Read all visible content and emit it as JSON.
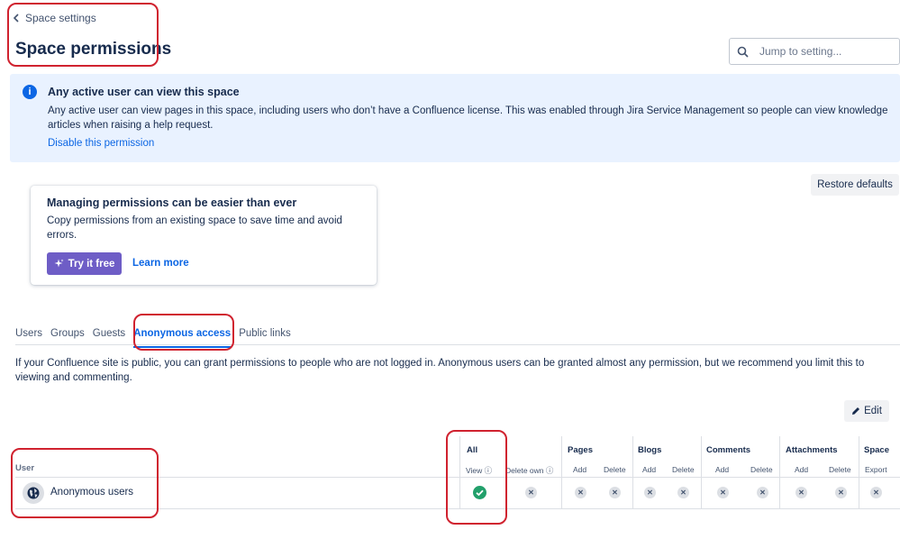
{
  "header": {
    "back_label": "Space settings",
    "title": "Space permissions",
    "search_placeholder": "Jump to setting..."
  },
  "banner": {
    "title": "Any active user can view this space",
    "body": "Any active user can view pages in this space, including users who don’t have a Confluence license. This was enabled through Jira Service Management so people can view knowledge articles when raising a help request.",
    "link": "Disable this permission",
    "icon": "info-icon"
  },
  "restore_label": "Restore defaults",
  "promo": {
    "title": "Managing permissions can be easier than ever",
    "body": "Copy permissions from an existing space to save time and avoid errors.",
    "try_label": "Try it free",
    "learn_label": "Learn more"
  },
  "tabs": [
    {
      "label": "Users"
    },
    {
      "label": "Groups"
    },
    {
      "label": "Guests"
    },
    {
      "label": "Anonymous access",
      "active": true
    },
    {
      "label": "Public links"
    }
  ],
  "description": "If your Confluence site is public, you can grant permissions to people who are not logged in. Anonymous users can be granted almost any permission, but we recommend you limit this to viewing and commenting.",
  "edit_label": "Edit",
  "table": {
    "user_header": "User",
    "groups": {
      "all": "All",
      "pages": "Pages",
      "blogs": "Blogs",
      "comments": "Comments",
      "attachments": "Attachments",
      "space": "Space"
    },
    "subs": {
      "view": "View",
      "delete_own": "Delete own",
      "pages_add": "Add",
      "pages_delete": "Delete",
      "blogs_add": "Add",
      "blogs_delete": "Delete",
      "comments_add": "Add",
      "comments_delete": "Delete",
      "attachments_add": "Add",
      "attachments_delete": "Delete",
      "space_export": "Export"
    },
    "row": {
      "name": "Anonymous users",
      "permissions": {
        "view": true,
        "delete_own": false,
        "pages_add": false,
        "pages_delete": false,
        "blogs_add": false,
        "blogs_delete": false,
        "comments_add": false,
        "comments_delete": false,
        "attachments_add": false,
        "attachments_delete": false,
        "space_export": false
      }
    }
  },
  "colors": {
    "accent": "#0c66e4",
    "banner_bg": "#e9f2ff",
    "granted": "#22a06b",
    "promo_button": "#6e5dc6",
    "annotation": "#d0222f"
  }
}
